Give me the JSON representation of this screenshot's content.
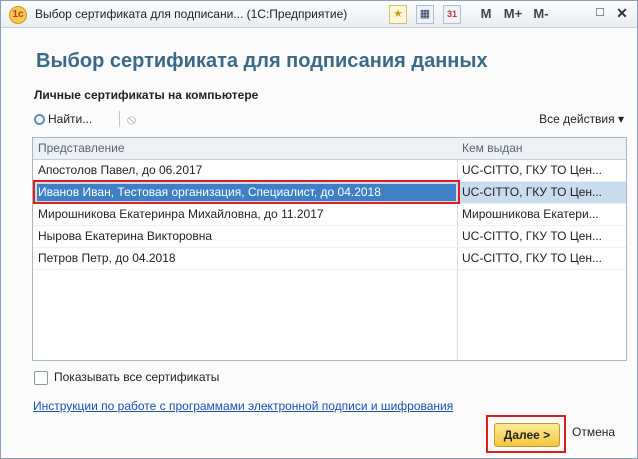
{
  "window": {
    "title": "Выбор сертификата для подписани... (1С:Предприятие)",
    "toolbar_buttons": [
      "M",
      "M+",
      "M-"
    ]
  },
  "form": {
    "title": "Выбор сертификата для подписания данных",
    "section_label": "Личные сертификаты на компьютере",
    "find_label": "Найти...",
    "all_actions_label": "Все действия ▾"
  },
  "table": {
    "columns": [
      "Представление",
      "Кем выдан"
    ],
    "rows": [
      [
        "Апостолов Павел, до 06.2017",
        "UC-CITTO, ГКУ ТО Цен..."
      ],
      [
        "Иванов Иван, Тестовая организация, Специалист, до 04.2018",
        "UC-CITTO, ГКУ ТО Цен..."
      ],
      [
        "Мирошникова Екатеринра Михайловна, до 11.2017",
        "Мирошникова Екатери..."
      ],
      [
        "Нырова Екатерина Викторовна",
        "UC-CITTO, ГКУ ТО Цен..."
      ],
      [
        "Петров Петр, до 04.2018",
        "UC-CITTO, ГКУ ТО Цен..."
      ]
    ],
    "selected_index": 1
  },
  "options": {
    "show_all_label": "Показывать все сертификаты",
    "show_all_checked": false
  },
  "link_text": "Инструкции по работе с программами электронной подписи и шифрования",
  "buttons": {
    "next": "Далее >",
    "cancel": "Отмена"
  },
  "colors": {
    "title": "#3b6a88",
    "selection": "#3f7fc5",
    "highlight_frame": "#e21b1b",
    "primary_button": "#f3c63e"
  }
}
